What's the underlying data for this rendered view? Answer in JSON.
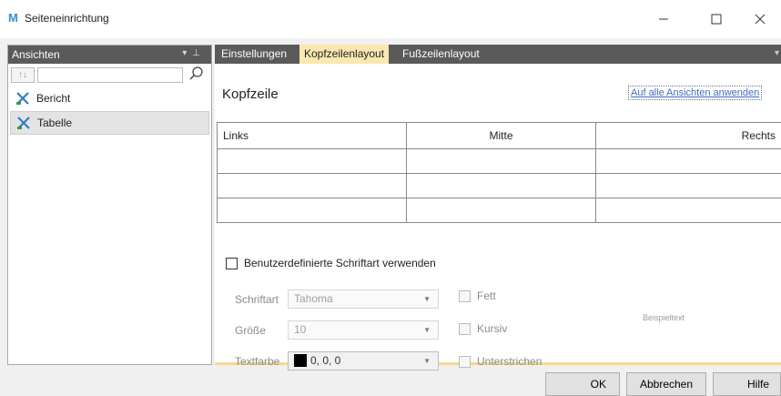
{
  "window": {
    "title": "Seiteneinrichtung",
    "icon": "app-logo-icon"
  },
  "left_pane": {
    "header": "Ansichten",
    "search": {
      "value": "",
      "placeholder": ""
    },
    "items": [
      {
        "label": "Bericht",
        "icon": "view-icon",
        "selected": false
      },
      {
        "label": "Tabelle",
        "icon": "view-icon",
        "selected": true
      }
    ]
  },
  "tabs": [
    {
      "label": "Einstellungen",
      "active": false
    },
    {
      "label": "Kopfzeilenlayout",
      "active": true
    },
    {
      "label": "Fußzeilenlayout",
      "active": false
    }
  ],
  "header_section": {
    "title": "Kopfzeile",
    "apply_link": "Auf alle Ansichten anwenden",
    "table": {
      "columns": [
        "Links",
        "Mitte",
        "Rechts"
      ],
      "rows": [
        [
          "",
          "",
          ""
        ],
        [
          "",
          "",
          ""
        ],
        [
          "",
          "",
          ""
        ]
      ]
    },
    "custom_font_label": "Benutzerdefinierte Schriftart verwenden",
    "font": {
      "family_label": "Schriftart",
      "family_value": "Tahoma",
      "size_label": "Größe",
      "size_value": "10",
      "color_label": "Textfarbe",
      "color_value": "0, 0, 0",
      "color_hex": "#000000"
    },
    "styles": {
      "bold": "Fett",
      "italic": "Kursiv",
      "underline": "Unterstrichen"
    },
    "preview_text": "Beispieltext"
  },
  "buttons": {
    "ok": "OK",
    "cancel": "Abbrechen",
    "help": "Hilfe"
  },
  "colors": {
    "accent_tab": "#fae8b0",
    "header_dark": "#5a5a5a",
    "link": "#3b6fc7"
  }
}
